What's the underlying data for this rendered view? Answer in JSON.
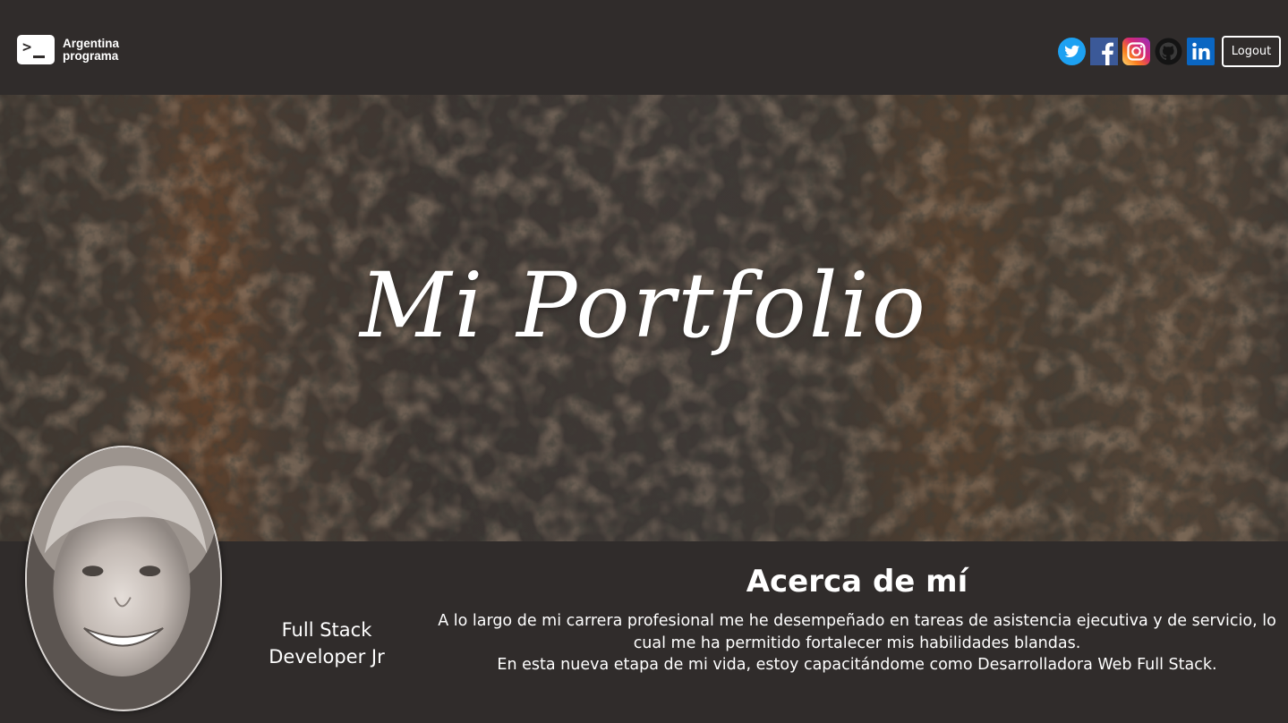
{
  "header": {
    "brand_line1": "Argentina",
    "brand_line2": "programa",
    "logout_label": "Logout",
    "social_icons": [
      "twitter-icon",
      "facebook-icon",
      "instagram-icon",
      "github-icon",
      "linkedin-icon"
    ]
  },
  "hero": {
    "title": "Mi Portfolio"
  },
  "profile": {
    "role_line1": "Full Stack",
    "role_line2": "Developer Jr"
  },
  "about": {
    "title": "Acerca de mí",
    "paragraph1": "A lo largo de mi carrera profesional me he desempeñado en tareas de asistencia ejecutiva y de servicio, lo cual me ha permitido fortalecer mis habilidades blandas.",
    "paragraph2": "En esta nueva etapa de mi vida, estoy capacitándome como Desarrolladora Web Full Stack."
  },
  "colors": {
    "background": "#302c2b",
    "text": "#ffffff",
    "twitter": "#1da1f2",
    "facebook": "#3b5998",
    "linkedin": "#0a66c2"
  }
}
